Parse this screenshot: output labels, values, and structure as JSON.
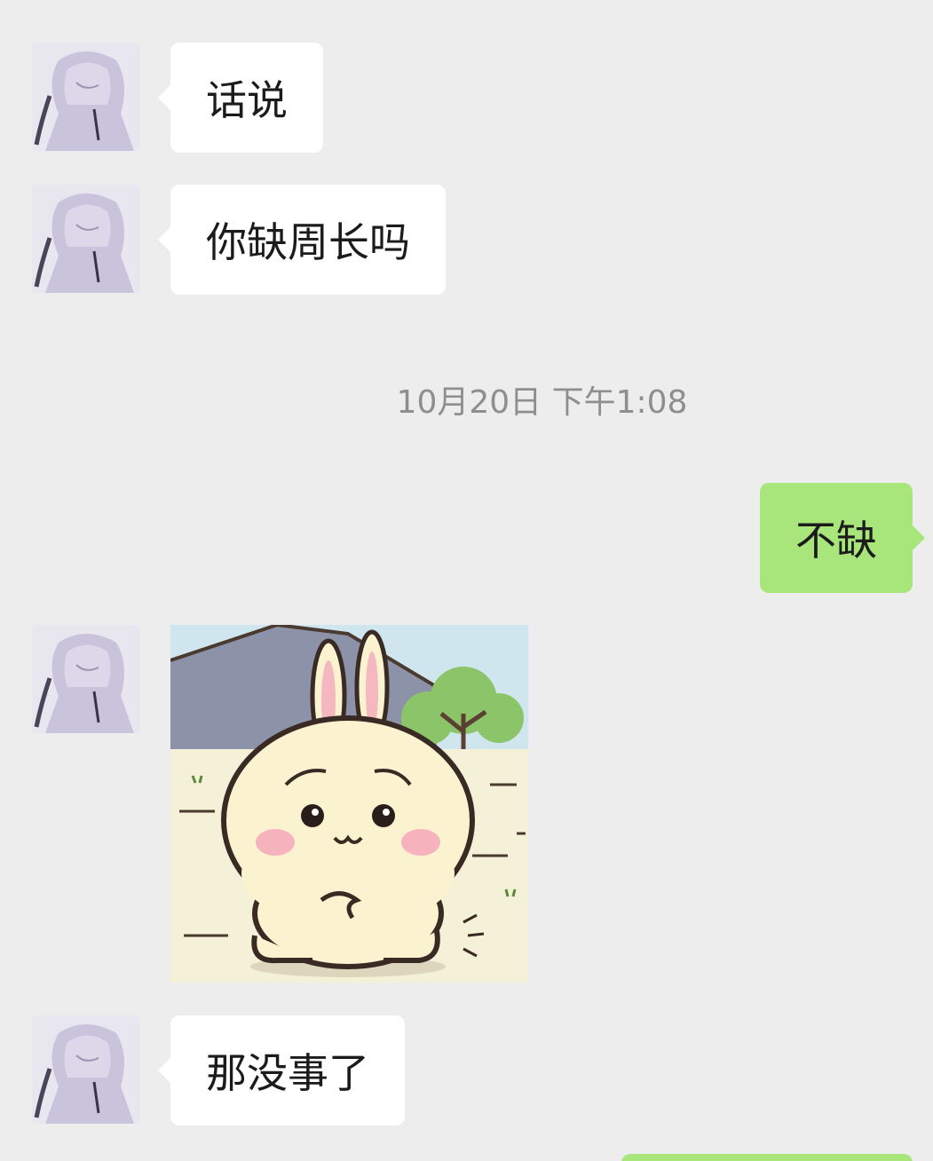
{
  "conversation": {
    "messages": [
      {
        "sender": "contact",
        "type": "text",
        "text": "话说"
      },
      {
        "sender": "contact",
        "type": "text",
        "text": "你缺周长吗"
      },
      {
        "type": "timestamp",
        "text": "10月20日 下午1:08"
      },
      {
        "sender": "me",
        "type": "text",
        "text": "不缺"
      },
      {
        "sender": "contact",
        "type": "sticker",
        "sticker": "bunny-sticker-icon"
      },
      {
        "sender": "contact",
        "type": "text",
        "text": "那没事了"
      }
    ]
  },
  "colors": {
    "background": "#ededed",
    "incoming_bubble": "#ffffff",
    "outgoing_bubble": "#a8e57a",
    "timestamp_text": "#8e8e8e"
  },
  "icons": {
    "contact_avatar": "anime-avatar-icon"
  }
}
